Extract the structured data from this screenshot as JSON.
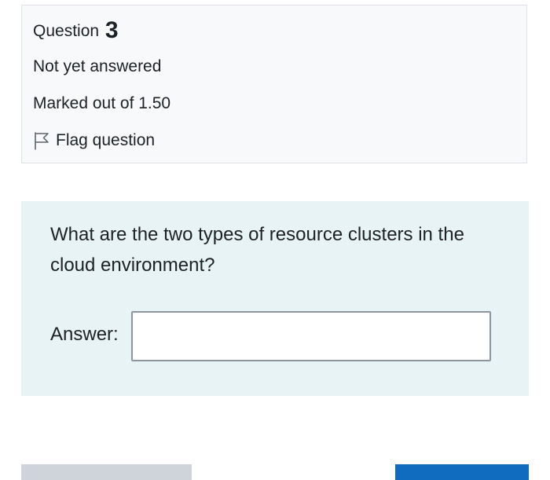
{
  "question_info": {
    "prefix": "Question",
    "number": "3",
    "state": "Not yet answered",
    "grade": "Marked out of 1.50",
    "flag_label": "Flag question",
    "flag_icon": "flag-outline-icon"
  },
  "question": {
    "text": "What are the two types of resource clusters in the cloud environment?",
    "answer_label": "Answer:",
    "answer_value": ""
  },
  "colors": {
    "info_background": "#f8f9fa",
    "content_background": "#e7f3f5",
    "previous_button": "#ced4da",
    "next_button": "#0f6cbf"
  }
}
